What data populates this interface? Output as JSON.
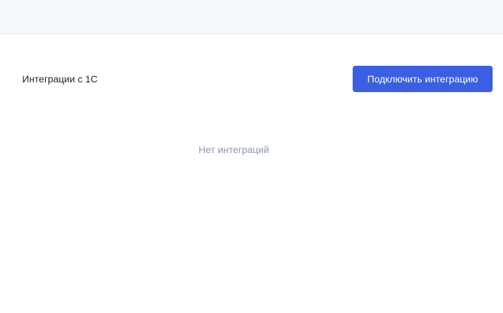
{
  "integrations": {
    "title": "Интеграции с 1С",
    "connect_label": "Подключить интеграцию",
    "empty_text": "Нет интеграций"
  },
  "colors": {
    "accent": "#3b5fe3",
    "topbar_bg": "#f7f8fc",
    "muted_text": "#8c95ad"
  }
}
